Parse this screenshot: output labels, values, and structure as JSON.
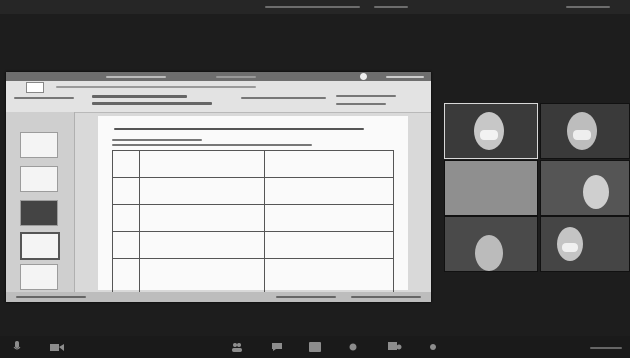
{
  "window": {
    "share_banner": "",
    "menu_items": [
      "",
      ""
    ]
  },
  "presentation": {
    "app_title": "",
    "slide_count": 5,
    "current_slide": 4
  },
  "participants": {
    "count": 6,
    "active_index": 0
  },
  "toolbar": {
    "icons": [
      "microphone-icon",
      "video-icon",
      "participants-icon",
      "chat-icon",
      "share-screen-icon",
      "record-icon",
      "reactions-icon",
      "more-icon"
    ]
  }
}
